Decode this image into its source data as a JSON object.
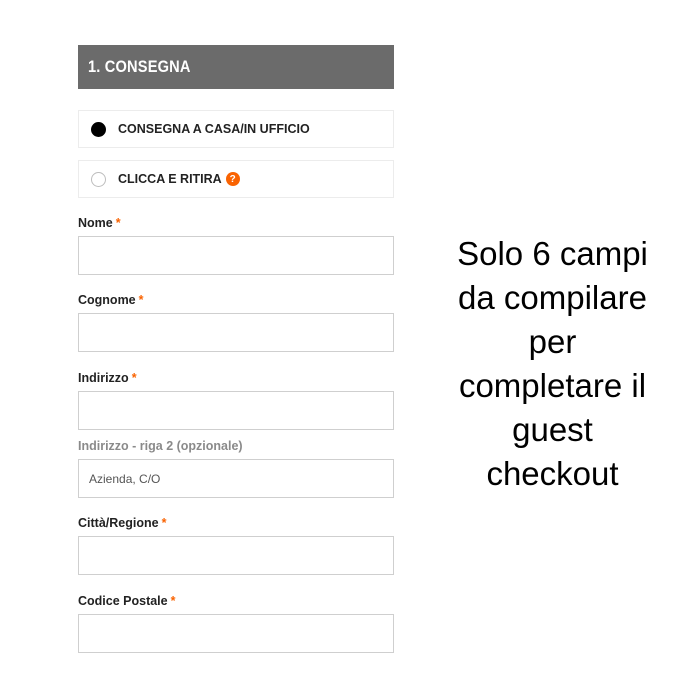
{
  "section": {
    "title": "1. CONSEGNA"
  },
  "delivery_options": [
    {
      "label": "CONSEGNA A CASA/IN UFFICIO",
      "selected": true
    },
    {
      "label": "CLICCA E RITIRA",
      "selected": false,
      "badge": "?"
    }
  ],
  "fields": [
    {
      "label": "Nome",
      "required_mark": "*",
      "value": "",
      "placeholder": ""
    },
    {
      "label": "Cognome",
      "required_mark": "*",
      "value": "",
      "placeholder": ""
    },
    {
      "label": "Indirizzo",
      "required_mark": "*",
      "value": "",
      "placeholder": ""
    },
    {
      "label": "Indirizzo - riga 2 (opzionale)",
      "required_mark": "",
      "value": "",
      "placeholder": "Azienda, C/O"
    },
    {
      "label": "Città/Regione",
      "required_mark": "*",
      "value": "",
      "placeholder": ""
    },
    {
      "label": "Codice Postale",
      "required_mark": "*",
      "value": "",
      "placeholder": ""
    }
  ],
  "side_note": {
    "lines": [
      "Solo 6 campi",
      "da compilare",
      "per",
      "completare il",
      "guest",
      "checkout"
    ]
  },
  "colors": {
    "header_bg": "#6b6b6b",
    "accent": "#f96302",
    "field_border": "#cfcfcf"
  }
}
